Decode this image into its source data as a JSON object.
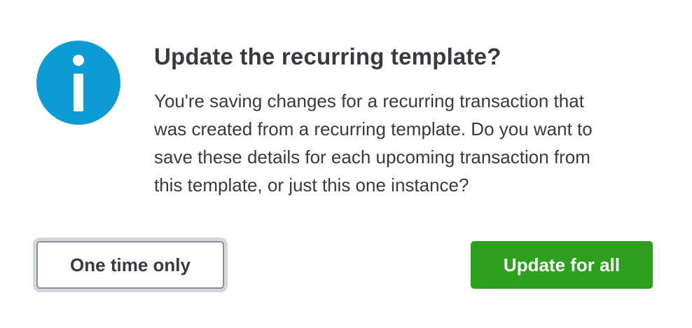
{
  "dialog": {
    "icon": "info-icon",
    "title": "Update the recurring template?",
    "message": "You're saving changes for a recurring transaction that\nwas created from a recurring template. Do you want to\nsave these details for each upcoming transaction from\nthis template, or just this one instance?",
    "buttons": {
      "secondary_label": "One time only",
      "primary_label": "Update for all"
    }
  },
  "colors": {
    "info_icon": "#0d9bd6",
    "primary_button": "#2ca01c",
    "text": "#393a3d",
    "secondary_border": "#8d9096",
    "focus_ring": "#d4d7dc"
  }
}
